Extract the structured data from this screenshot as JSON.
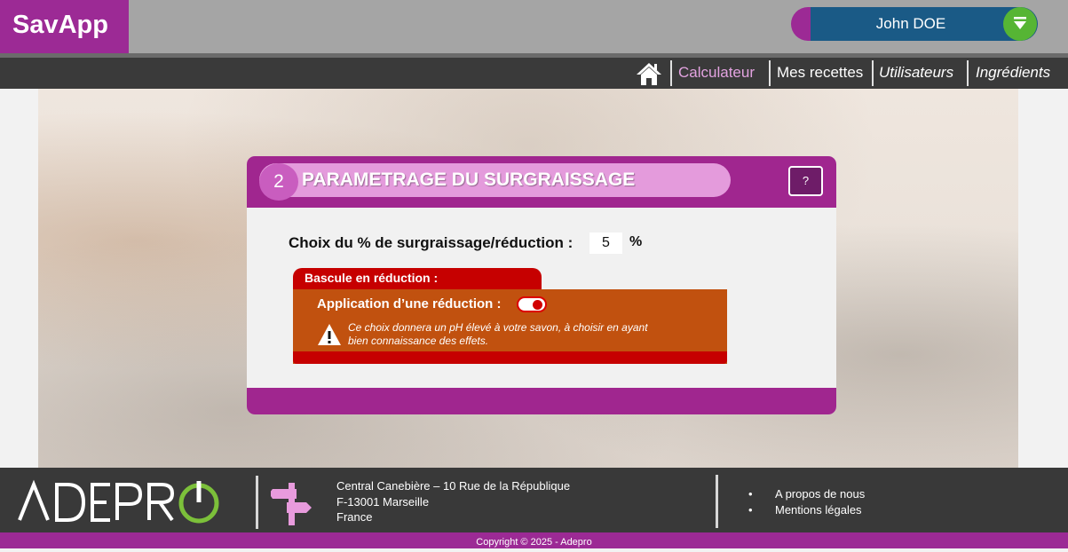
{
  "app": {
    "title": "SavApp"
  },
  "user": {
    "name": "John DOE",
    "menu_icon": "chevron-down-icon"
  },
  "nav": {
    "home_icon": "home-icon",
    "items": [
      {
        "label": "Calculateur",
        "state": "active"
      },
      {
        "label": "Mes recettes"
      },
      {
        "label": "Utilisateurs"
      },
      {
        "label": "Ingrédients"
      }
    ]
  },
  "step": {
    "number": "2",
    "title": "PARAMETRAGE DU SURGRAISSAGE",
    "help_label": "?",
    "choice_label": "Choix du % de surgraissage/réduction :",
    "choice_value": "5",
    "choice_unit": "%",
    "bascule_title": "Bascule en réduction :",
    "apply_label": "Application d’une réduction :",
    "reduction_enabled": true,
    "warning_text": "Ce choix donnera un pH élevé à votre savon, à choisir en ayant bien connaissance des effets."
  },
  "footer": {
    "brand": "ADEPRO",
    "address_lines": [
      "Central Canebière – 10 Rue de la République",
      "F-13001 Marseille",
      "France"
    ],
    "links": [
      "A propos de nous",
      "Mentions légales"
    ],
    "copyright": "Copyright © 2025 - Adepro"
  },
  "colors": {
    "brand_purple": "#9c2a95",
    "user_blue": "#1a5a86",
    "accent_green": "#56b534",
    "warning_orange": "#c1510f",
    "alert_red": "#c60000"
  }
}
